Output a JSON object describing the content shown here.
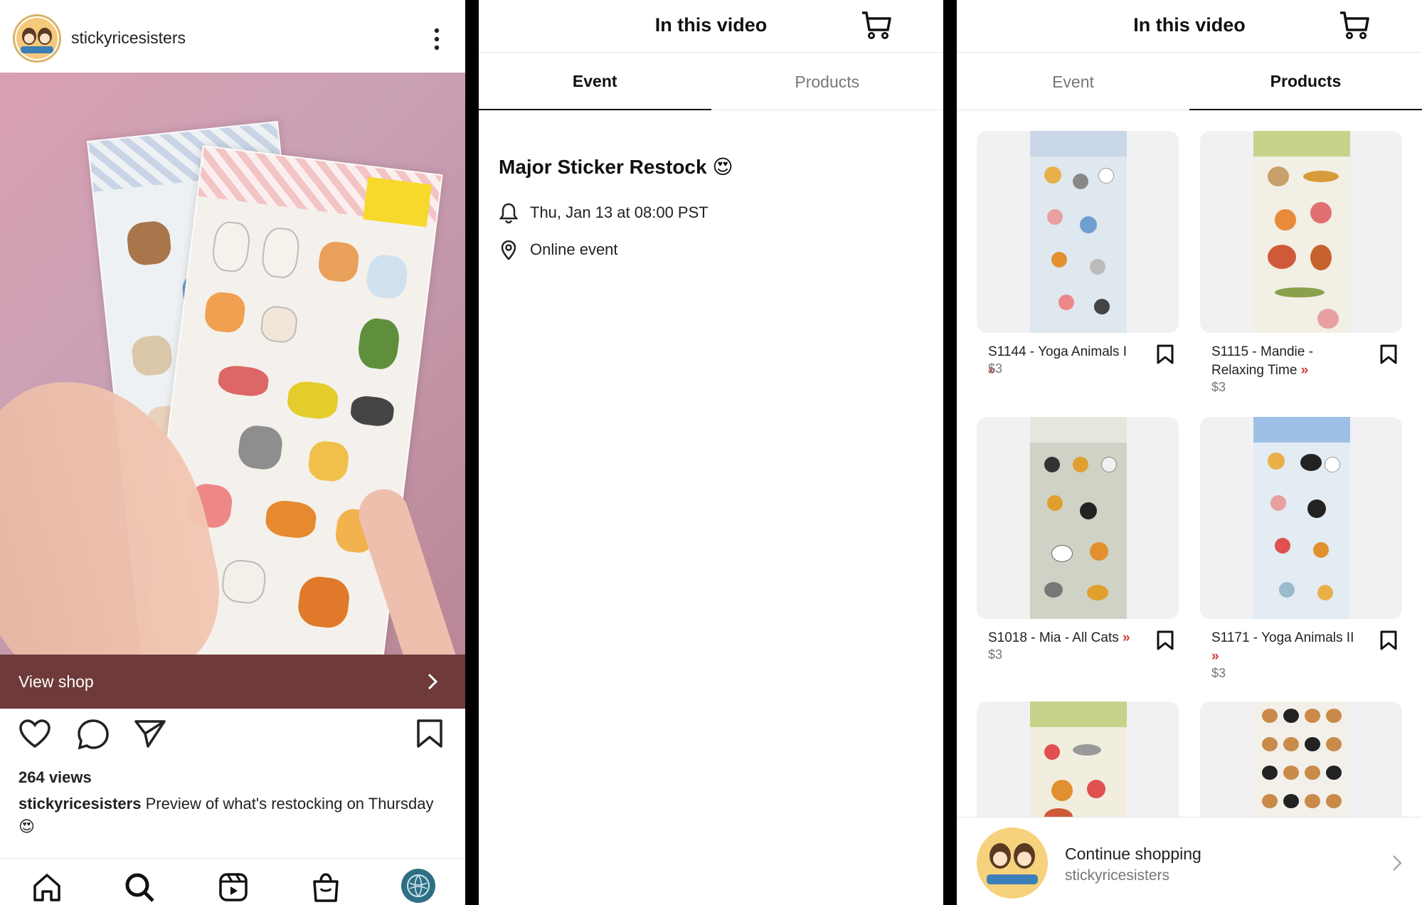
{
  "post": {
    "username": "stickyricesisters",
    "view_shop_label": "View shop",
    "views": "264 views",
    "caption_user": "stickyricesisters",
    "caption_text": "Preview of what's restocking on Thursday",
    "caption_emoji": "😍"
  },
  "sheet": {
    "title": "In this video",
    "tabs": [
      "Event",
      "Products"
    ]
  },
  "event": {
    "title": "Major Sticker Restock 😍",
    "datetime": "Thu, Jan 13 at 08:00 PST",
    "location": "Online event"
  },
  "products": [
    {
      "name": "S1144 - Yoga Animals I",
      "price": "$3"
    },
    {
      "name": "S1115 - Mandie - Relaxing Time",
      "price": "$3"
    },
    {
      "name": "S1018 - Mia - All Cats",
      "price": "$3"
    },
    {
      "name": "S1171 - Yoga Animals II",
      "price": "$3"
    }
  ],
  "continue": {
    "title": "Continue shopping",
    "subtitle": "stickyricesisters"
  },
  "colors": {
    "view_shop_bg": "#6e3a3a",
    "arrow_red": "#d23a3a",
    "avatar_ring": "#d9b36a"
  },
  "icons": [
    "more-icon",
    "bell-icon",
    "sound-icon",
    "chevron-right-icon",
    "heart-icon",
    "comment-icon",
    "share-icon",
    "bookmark-icon",
    "home-icon",
    "search-icon",
    "reels-icon",
    "shop-icon",
    "profile-icon",
    "cart-icon",
    "location-pin-icon"
  ]
}
